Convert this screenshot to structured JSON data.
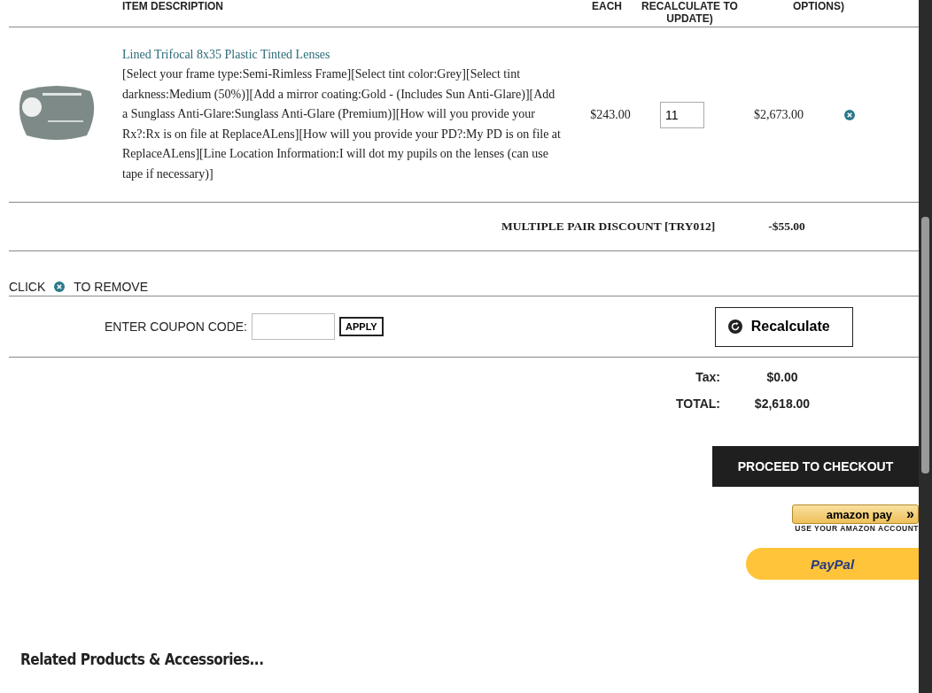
{
  "cart_header": {
    "columns": [
      {
        "kind": "desc",
        "lines": [
          "ITEM DESCRIPTION"
        ]
      },
      {
        "kind": "each",
        "lines": [
          "EACH"
        ]
      },
      {
        "kind": "qty",
        "lines": [
          "RECALCULATE TO",
          "UPDATE)"
        ]
      },
      {
        "kind": "total",
        "lines": [
          "OPTIONS)"
        ]
      }
    ]
  },
  "items": [
    {
      "name": "Lined Trifocal 8x35 Plastic Tinted Lenses",
      "options": "[Select your frame type:Semi-Rimless Frame][Select tint color:Grey][Select tint darkness:Medium (50%)][Add a mirror coating:Gold - (Includes Sun Anti-Glare)][Add a Sunglass Anti-Glare:Sunglass Anti-Glare (Premium)][How will you provide your Rx?:Rx is on file at ReplaceALens][How will you provide your PD?:My PD is on file at ReplaceALens][Line Location Information:I will dot my pupils on the lenses (can use tape if necessary)]",
      "each": "$243.00",
      "quantity": "11",
      "total": "$2,673.00"
    }
  ],
  "discount": {
    "label": "MULTIPLE PAIR DISCOUNT [TRY012]",
    "amount": "-$55.00"
  },
  "remove_hint": {
    "before": "CLICK",
    "after": "TO REMOVE"
  },
  "coupon": {
    "label": "ENTER COUPON CODE:",
    "button": "APPLY"
  },
  "recalculate_button": "Recalculate",
  "totals": [
    {
      "label": "Tax:",
      "value": "$0.00"
    },
    {
      "label": "TOTAL:",
      "value": "$2,618.00"
    }
  ],
  "checkout_button": "PROCEED TO CHECKOUT",
  "amazon_pay": {
    "label": "amazon pay",
    "arrows": "»",
    "caption": "USE YOUR AMAZON ACCOUNT"
  },
  "paypal_button": "PayPal",
  "related_heading": "Related Products & Accessories..."
}
